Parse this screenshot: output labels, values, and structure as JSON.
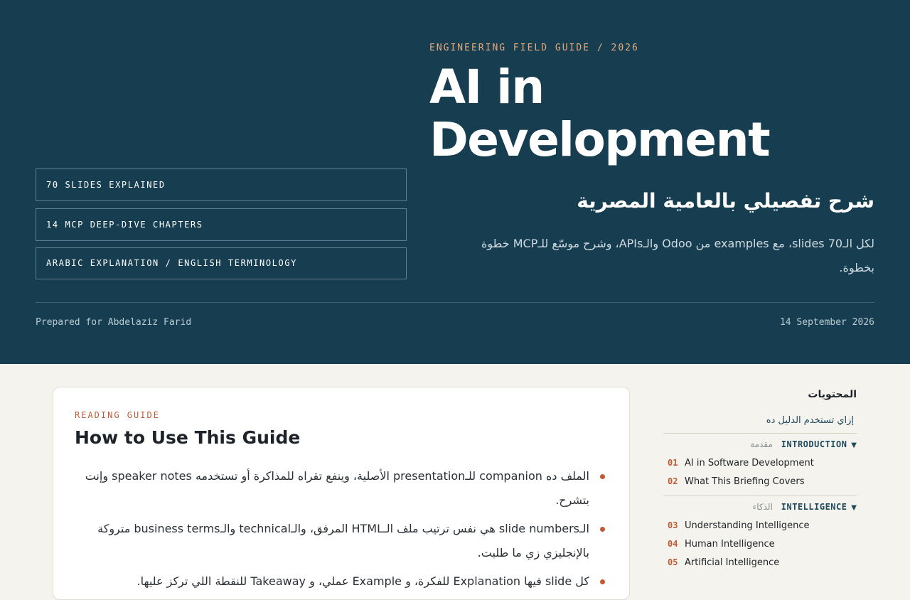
{
  "hero": {
    "eyebrow": "ENGINEERING FIELD GUIDE / 2026",
    "title": "AI in Development",
    "subtitle_ar": "شرح تفصيلي بالعامية المصرية",
    "description_ar": "لكل الـ70 slides، مع examples من Odoo والـAPIs، وشرح موسّع للـMCP خطوة بخطوة.",
    "stats": [
      "70 SLIDES EXPLAINED",
      "14 MCP DEEP-DIVE CHAPTERS",
      "ARABIC EXPLANATION / ENGLISH TERMINOLOGY"
    ],
    "prepared_for": "Prepared for Abdelaziz Farid",
    "date": "14 September 2026"
  },
  "guide_card": {
    "eyebrow": "READING GUIDE",
    "title": "How to Use This Guide",
    "bullets": [
      "الملف ده companion للـpresentation الأصلية، وينفع تقراه للمذاكرة أو تستخدمه speaker notes وإنت بتشرح.",
      "الـslide numbers هي نفس ترتيب ملف الـHTML المرفق، والـtechnical والـbusiness terms متروكة بالإنجليزي زي ما طلبت.",
      "كل slide فيها Explanation للفكرة، و Example عملي، و Takeaway للنقطة اللي تركز عليها."
    ]
  },
  "toc": {
    "heading": "المحتويات",
    "intro_link": "إزاي تستخدم الدليل ده",
    "sections": [
      {
        "label_en": "INTRODUCTION",
        "label_ar": "مقدمة",
        "items": [
          {
            "num": "01",
            "title": "AI in Software Development"
          },
          {
            "num": "02",
            "title": "What This Briefing Covers"
          }
        ]
      },
      {
        "label_en": "INTELLIGENCE",
        "label_ar": "الذكاء",
        "items": [
          {
            "num": "03",
            "title": "Understanding Intelligence"
          },
          {
            "num": "04",
            "title": "Human Intelligence"
          },
          {
            "num": "05",
            "title": "Artificial Intelligence"
          }
        ]
      }
    ],
    "chevron_glyph": "▼"
  }
}
